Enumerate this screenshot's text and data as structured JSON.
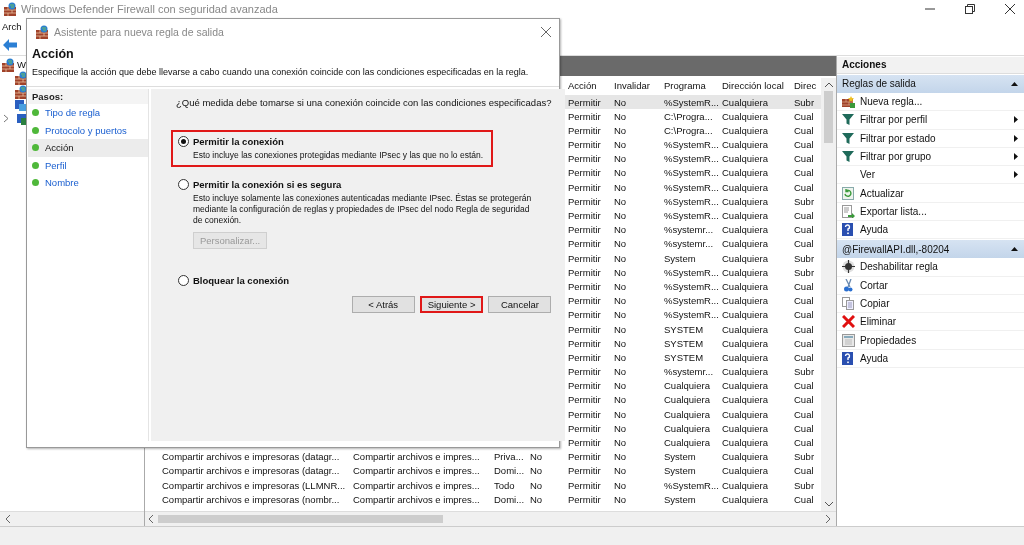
{
  "main_window": {
    "title": "Windows Defender Firewall con seguridad avanzada",
    "menu": [
      "Arch"
    ],
    "tree": {
      "root": "W"
    }
  },
  "rules_table": {
    "columns": [
      "Acción",
      "Invalidar",
      "Programa",
      "Dirección local",
      "Direc"
    ],
    "rows": [
      {
        "selected": true,
        "action": "Permitir",
        "override": "No",
        "program": "%SystemR...",
        "local_address": "Cualquiera",
        "column_9": "Subr"
      },
      {
        "selected": false,
        "action": "Permitir",
        "override": "No",
        "program": "C:\\Progra...",
        "local_address": "Cualquiera",
        "column_9": "Cual"
      },
      {
        "selected": false,
        "action": "Permitir",
        "override": "No",
        "program": "C:\\Progra...",
        "local_address": "Cualquiera",
        "column_9": "Cual"
      },
      {
        "selected": false,
        "action": "Permitir",
        "override": "No",
        "program": "%SystemR...",
        "local_address": "Cualquiera",
        "column_9": "Cual"
      },
      {
        "selected": false,
        "action": "Permitir",
        "override": "No",
        "program": "%SystemR...",
        "local_address": "Cualquiera",
        "column_9": "Cual"
      },
      {
        "selected": false,
        "action": "Permitir",
        "override": "No",
        "program": "%SystemR...",
        "local_address": "Cualquiera",
        "column_9": "Cual"
      },
      {
        "selected": false,
        "action": "Permitir",
        "override": "No",
        "program": "%SystemR...",
        "local_address": "Cualquiera",
        "column_9": "Cual"
      },
      {
        "selected": false,
        "action": "Permitir",
        "override": "No",
        "program": "%SystemR...",
        "local_address": "Cualquiera",
        "column_9": "Subr"
      },
      {
        "selected": false,
        "action": "Permitir",
        "override": "No",
        "program": "%SystemR...",
        "local_address": "Cualquiera",
        "column_9": "Cual"
      },
      {
        "selected": false,
        "action": "Permitir",
        "override": "No",
        "program": "%systemr...",
        "local_address": "Cualquiera",
        "column_9": "Cual"
      },
      {
        "selected": false,
        "action": "Permitir",
        "override": "No",
        "program": "%systemr...",
        "local_address": "Cualquiera",
        "column_9": "Cual"
      },
      {
        "selected": false,
        "action": "Permitir",
        "override": "No",
        "program": "System",
        "local_address": "Cualquiera",
        "column_9": "Subr"
      },
      {
        "selected": false,
        "action": "Permitir",
        "override": "No",
        "program": "%SystemR...",
        "local_address": "Cualquiera",
        "column_9": "Subr"
      },
      {
        "selected": false,
        "action": "Permitir",
        "override": "No",
        "program": "%SystemR...",
        "local_address": "Cualquiera",
        "column_9": "Cual"
      },
      {
        "selected": false,
        "action": "Permitir",
        "override": "No",
        "program": "%SystemR...",
        "local_address": "Cualquiera",
        "column_9": "Cual"
      },
      {
        "selected": false,
        "action": "Permitir",
        "override": "No",
        "program": "%SystemR...",
        "local_address": "Cualquiera",
        "column_9": "Cual"
      },
      {
        "selected": false,
        "action": "Permitir",
        "override": "No",
        "program": "SYSTEM",
        "local_address": "Cualquiera",
        "column_9": "Cual"
      },
      {
        "selected": false,
        "action": "Permitir",
        "override": "No",
        "program": "SYSTEM",
        "local_address": "Cualquiera",
        "column_9": "Cual"
      },
      {
        "selected": false,
        "action": "Permitir",
        "override": "No",
        "program": "SYSTEM",
        "local_address": "Cualquiera",
        "column_9": "Cual"
      },
      {
        "selected": false,
        "action": "Permitir",
        "override": "No",
        "program": "%systemr...",
        "local_address": "Cualquiera",
        "column_9": "Subr"
      },
      {
        "selected": false,
        "action": "Permitir",
        "override": "No",
        "program": "Cualquiera",
        "local_address": "Cualquiera",
        "column_9": "Cual"
      },
      {
        "selected": false,
        "action": "Permitir",
        "override": "No",
        "program": "Cualquiera",
        "local_address": "Cualquiera",
        "column_9": "Cual"
      },
      {
        "selected": false,
        "action": "Permitir",
        "override": "No",
        "program": "Cualquiera",
        "local_address": "Cualquiera",
        "column_9": "Cual"
      },
      {
        "selected": false,
        "action": "Permitir",
        "override": "No",
        "program": "Cualquiera",
        "local_address": "Cualquiera",
        "column_9": "Cual"
      },
      {
        "selected": false,
        "action": "Permitir",
        "override": "No",
        "program": "Cualquiera",
        "local_address": "Cualquiera",
        "column_9": "Cual"
      },
      {
        "selected": false,
        "name": "Compartir archivos e impresoras (datagr...",
        "group": "Compartir archivos e impres...",
        "profile": "Priva...",
        "enabled": "No",
        "action": "Permitir",
        "override": "No",
        "program": "System",
        "local_address": "Cualquiera",
        "column_9": "Subr"
      },
      {
        "selected": false,
        "name": "Compartir archivos e impresoras (datagr...",
        "group": "Compartir archivos e impres...",
        "profile": "Domi...",
        "enabled": "No",
        "action": "Permitir",
        "override": "No",
        "program": "System",
        "local_address": "Cualquiera",
        "column_9": "Cual"
      },
      {
        "selected": false,
        "name": "Compartir archivos e impresoras (LLMNR...",
        "group": "Compartir archivos e impres...",
        "profile": "Todo",
        "enabled": "No",
        "action": "Permitir",
        "override": "No",
        "program": "%SystemR...",
        "local_address": "Cualquiera",
        "column_9": "Subr"
      },
      {
        "selected": false,
        "name": "Compartir archivos e impresoras (nombr...",
        "group": "Compartir archivos e impres...",
        "profile": "Domi...",
        "enabled": "No",
        "action": "Permitir",
        "override": "No",
        "program": "System",
        "local_address": "Cualquiera",
        "column_9": "Cual"
      }
    ]
  },
  "actions_pane": {
    "title": "Acciones",
    "sections": [
      {
        "title": "Reglas de salida",
        "expanded": true,
        "items": [
          {
            "label": "Nueva regla...",
            "kind": "new",
            "submenu": false
          },
          {
            "label": "Filtrar por perfil",
            "kind": "filter",
            "submenu": true
          },
          {
            "label": "Filtrar por estado",
            "kind": "filter",
            "submenu": true
          },
          {
            "label": "Filtrar por grupo",
            "kind": "filter",
            "submenu": true
          },
          {
            "label": "Ver",
            "kind": "plain",
            "submenu": true
          },
          {
            "label": "Actualizar",
            "kind": "refresh",
            "submenu": false
          },
          {
            "label": "Exportar lista...",
            "kind": "export",
            "submenu": false
          },
          {
            "label": "Ayuda",
            "kind": "help",
            "submenu": false
          }
        ]
      },
      {
        "title": "@FirewallAPI.dll,-80204",
        "expanded": true,
        "items": [
          {
            "label": "Deshabilitar regla",
            "kind": "disable",
            "submenu": false
          },
          {
            "label": "Cortar",
            "kind": "cut",
            "submenu": false
          },
          {
            "label": "Copiar",
            "kind": "copy",
            "submenu": false
          },
          {
            "label": "Eliminar",
            "kind": "delete",
            "submenu": false
          },
          {
            "label": "Propiedades",
            "kind": "properties",
            "submenu": false
          },
          {
            "label": "Ayuda",
            "kind": "help",
            "submenu": false
          }
        ]
      }
    ]
  },
  "dialog": {
    "title": "Asistente para nueva regla de salida",
    "heading": "Acción",
    "description": "Especifique la acción que debe llevarse a cabo cuando una conexión coincide con las condiciones especificadas en la regla.",
    "steps_title": "Pasos:",
    "steps": [
      {
        "label": "Tipo de regla",
        "selected": false
      },
      {
        "label": "Protocolo y puertos",
        "selected": false
      },
      {
        "label": "Acción",
        "selected": true
      },
      {
        "label": "Perfil",
        "selected": false
      },
      {
        "label": "Nombre",
        "selected": false
      }
    ],
    "question": "¿Qué medida debe tomarse si una conexión coincide con las condiciones especificadas?",
    "options": [
      {
        "label": "Permitir la conexión",
        "description": "Esto incluye las conexiones protegidas mediante IPsec y las que no lo están.",
        "selected": true,
        "highlighted": true
      },
      {
        "label": "Permitir la conexión si es segura",
        "description": "Esto incluye solamente las conexiones autenticadas mediante IPsec. Éstas se protegerán mediante la configuración de reglas y propiedades de IPsec del nodo Regla de seguridad de conexión.",
        "selected": false,
        "highlighted": false,
        "button": {
          "label": "Personalizar...",
          "disabled": true
        }
      },
      {
        "label": "Bloquear la conexión",
        "selected": false,
        "highlighted": false
      }
    ],
    "buttons": [
      {
        "label": "< Atrás",
        "highlighted": false
      },
      {
        "label": "Siguiente >",
        "highlighted": true
      },
      {
        "label": "Cancelar",
        "highlighted": false
      }
    ]
  }
}
